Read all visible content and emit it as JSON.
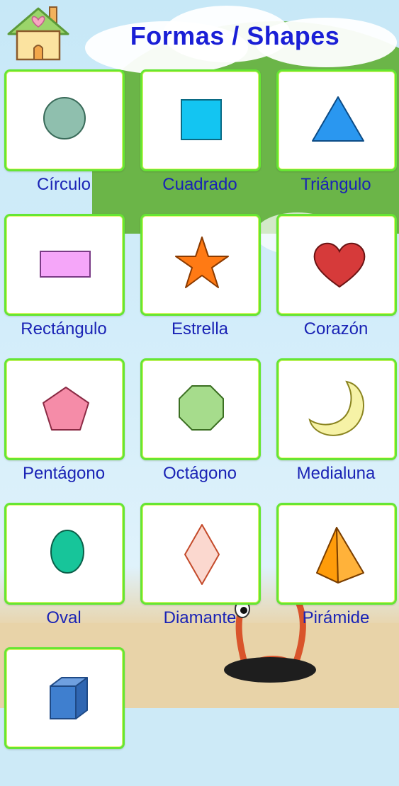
{
  "header": {
    "title": "Formas / Shapes",
    "home_icon": "house-icon"
  },
  "shapes": [
    {
      "label": "Círculo",
      "icon": "circle-icon",
      "color": "#8fbfae"
    },
    {
      "label": "Cuadrado",
      "icon": "square-icon",
      "color": "#13c5f2"
    },
    {
      "label": "Triángulo",
      "icon": "triangle-icon",
      "color": "#2a97f0"
    },
    {
      "label": "Rectángulo",
      "icon": "rectangle-icon",
      "color": "#f5a6f9"
    },
    {
      "label": "Estrella",
      "icon": "star-icon",
      "color": "#ff7a14"
    },
    {
      "label": "Corazón",
      "icon": "heart-icon",
      "color": "#d63a3a"
    },
    {
      "label": "Pentágono",
      "icon": "pentagon-icon",
      "color": "#f58ca8"
    },
    {
      "label": "Octágono",
      "icon": "octagon-icon",
      "color": "#a6dc8c"
    },
    {
      "label": "Medialuna",
      "icon": "crescent-icon",
      "color": "#f6f2a6"
    },
    {
      "label": "Oval",
      "icon": "oval-icon",
      "color": "#17c59a"
    },
    {
      "label": "Diamante",
      "icon": "diamond-icon",
      "color": "#fbd8cf"
    },
    {
      "label": "Pirámide",
      "icon": "pyramid-icon",
      "color": "#ff9c0a"
    },
    {
      "label": "",
      "icon": "cube-icon",
      "color": "#3f7fcf"
    }
  ]
}
